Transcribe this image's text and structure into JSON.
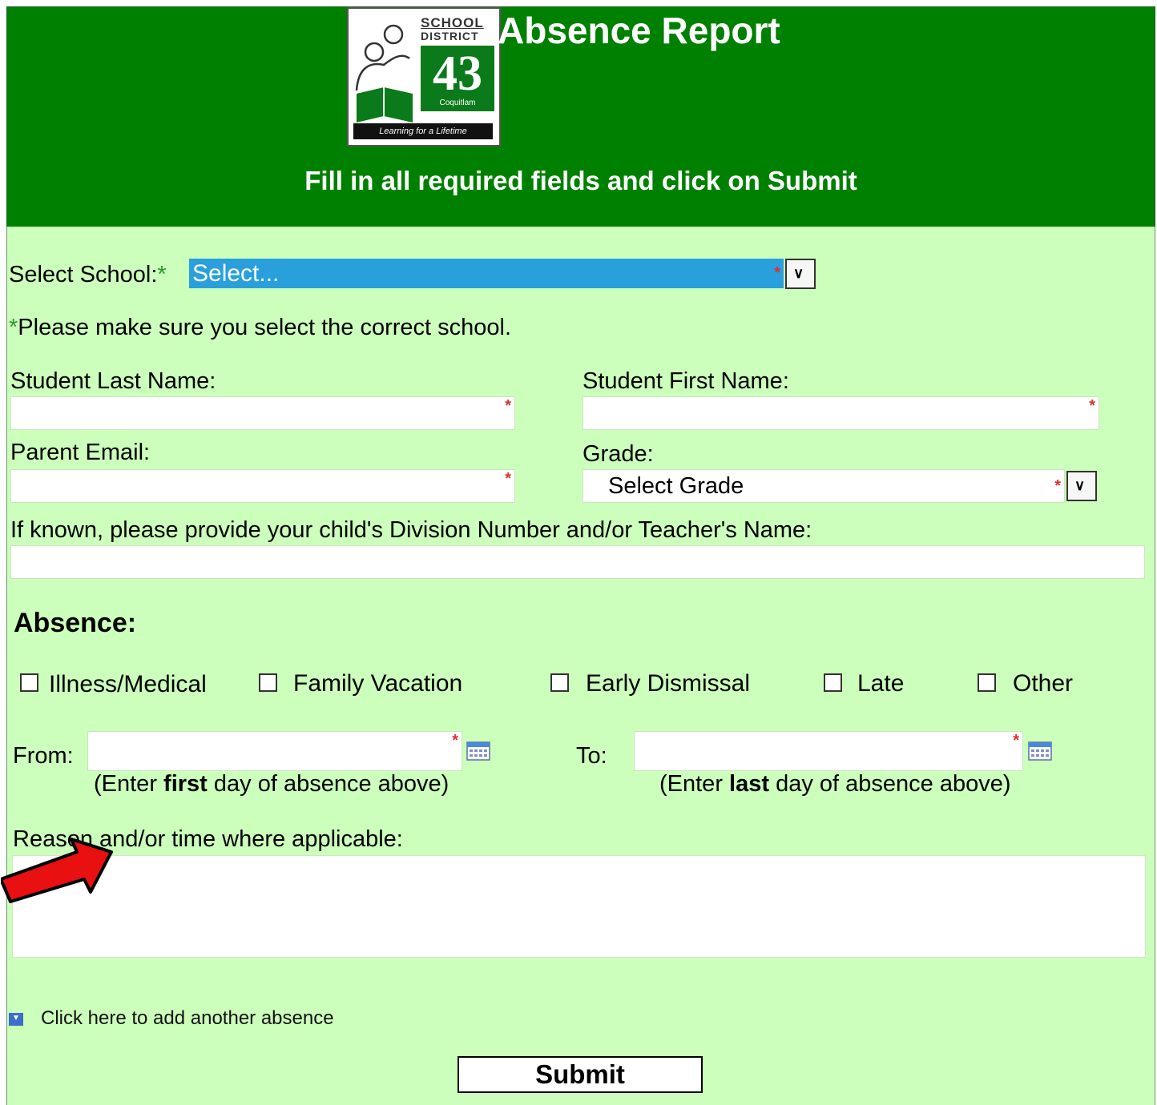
{
  "header": {
    "title": "Absence Report",
    "instructions": "Fill in all required fields and click on Submit",
    "logo": {
      "line1": "SCHOOL",
      "line2": "DISTRICT",
      "number": "43",
      "city": "Coquitlam",
      "motto": "Learning for a Lifetime"
    }
  },
  "form": {
    "school": {
      "label": "Select School:",
      "required_marker": "*",
      "value": "Select...",
      "note_marker": "*",
      "note": "Please make sure you select the correct school."
    },
    "last_name": {
      "label": "Student Last Name:",
      "value": ""
    },
    "first_name": {
      "label": "Student First Name:",
      "value": ""
    },
    "email": {
      "label": "Parent Email:",
      "value": ""
    },
    "grade": {
      "label": "Grade:",
      "value": "Select Grade"
    },
    "division": {
      "label": "If known, please provide your child's Division Number and/or Teacher's Name:",
      "value": ""
    },
    "absence": {
      "heading": "Absence:",
      "types": [
        "Illness/Medical",
        "Family Vacation",
        "Early Dismissal",
        "Late",
        "Other"
      ],
      "from_label": "From:",
      "to_label": "To:",
      "from_hint": {
        "pre": "(Enter ",
        "bold": "first",
        "post": " day of absence above)"
      },
      "to_hint": {
        "pre": "(Enter ",
        "bold": "last",
        "post": " day of absence above)"
      },
      "reason_label": "Reason and/or time where applicable:",
      "reason_value": ""
    },
    "required_star": "*",
    "add_absence": "Click here to add another absence",
    "submit": "Submit"
  },
  "colors": {
    "header_bg": "#008000",
    "form_bg": "#ccffbb",
    "select_highlight": "#29a0dc",
    "required_star": "#e03030",
    "annotation_arrow": "#e81010"
  }
}
